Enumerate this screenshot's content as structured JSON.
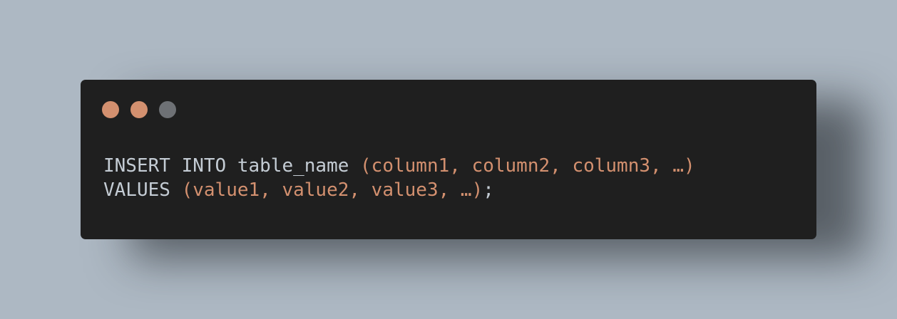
{
  "window": {
    "controls": [
      {
        "name": "close",
        "color": "#d3906f"
      },
      {
        "name": "minimize",
        "color": "#d3906f"
      },
      {
        "name": "maximize",
        "color": "#6e7175"
      }
    ],
    "colors": {
      "keyword": "#c4ccd4",
      "paren": "#d3906f",
      "background": "#1f1f1f",
      "page_background": "#adb8c3"
    }
  },
  "code": {
    "line1": {
      "keyword": "INSERT INTO table_name ",
      "args": "(column1, column2, column3, …)"
    },
    "line2": {
      "keyword": "VALUES ",
      "args": "(value1, value2, value3, …)",
      "terminator": ";"
    }
  }
}
